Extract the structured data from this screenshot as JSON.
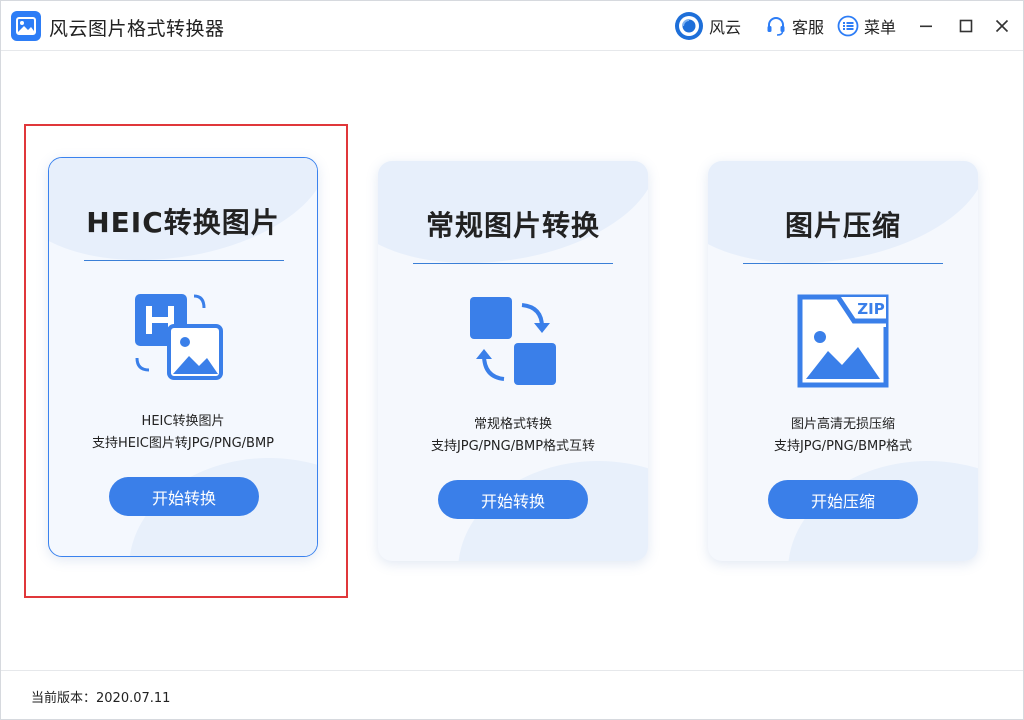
{
  "app": {
    "title": "风云图片格式转换器"
  },
  "toolbar": {
    "brand_label": "风云",
    "service_label": "客服",
    "menu_label": "菜单"
  },
  "cards": [
    {
      "title": "HEIC转换图片",
      "desc_line1": "HEIC转换图片",
      "desc_line2": "支持HEIC图片转JPG/PNG/BMP",
      "button_label": "开始转换",
      "icon": "heic-convert-icon",
      "selected": true
    },
    {
      "title": "常规图片转换",
      "desc_line1": "常规格式转换",
      "desc_line2": "支持JPG/PNG/BMP格式互转",
      "button_label": "开始转换",
      "icon": "format-swap-icon",
      "selected": false
    },
    {
      "title": "图片压缩",
      "desc_line1": "图片高清无损压缩",
      "desc_line2": "支持JPG/PNG/BMP格式",
      "button_label": "开始压缩",
      "icon": "zip-image-icon",
      "icon_text": "ZIP",
      "selected": false
    }
  ],
  "footer": {
    "version_text": "当前版本：2020.07.11"
  },
  "colors": {
    "accent": "#3a7fe9",
    "highlight_frame": "#e0373a",
    "card_bg": "#f5f8fd"
  }
}
